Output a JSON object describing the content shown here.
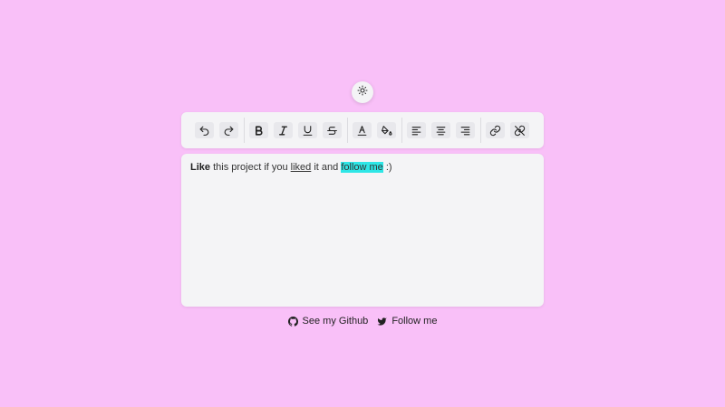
{
  "theme_toggle": {
    "icon": "sun-icon"
  },
  "toolbar": {
    "buttons": [
      {
        "name": "undo",
        "icon": "undo-icon"
      },
      {
        "name": "redo",
        "icon": "redo-icon"
      },
      {
        "name": "bold",
        "icon": "bold-icon"
      },
      {
        "name": "italic",
        "icon": "italic-icon"
      },
      {
        "name": "underline",
        "icon": "underline-icon"
      },
      {
        "name": "strikethrough",
        "icon": "strikethrough-icon"
      },
      {
        "name": "font-color",
        "icon": "font-color-icon"
      },
      {
        "name": "highlight-color",
        "icon": "paint-bucket-icon"
      },
      {
        "name": "align-left",
        "icon": "align-left-icon"
      },
      {
        "name": "align-center",
        "icon": "align-center-icon"
      },
      {
        "name": "align-right",
        "icon": "align-right-icon"
      },
      {
        "name": "link",
        "icon": "link-icon"
      },
      {
        "name": "unlink",
        "icon": "unlink-icon"
      }
    ]
  },
  "editor": {
    "segments": {
      "bold_text": "Like",
      "text_1": " this project if you ",
      "underline_text": "liked",
      "text_2": " it and ",
      "highlight_text": "follow me",
      "text_3": " :)"
    },
    "highlight_color": "#2ee6e6"
  },
  "footer": {
    "github_label": "See my Github",
    "twitter_label": "Follow me"
  },
  "colors": {
    "background": "#f9c0f8",
    "panel": "#f4f4f6",
    "button": "#e8e8ec"
  }
}
